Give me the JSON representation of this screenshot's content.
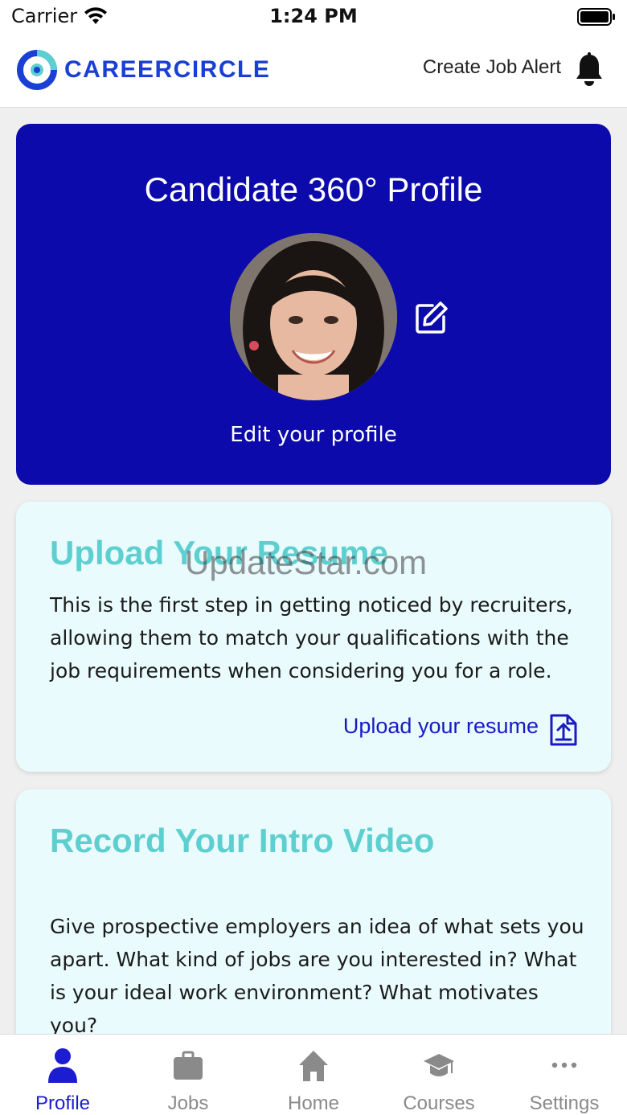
{
  "status_bar": {
    "carrier": "Carrier",
    "time": "1:24 PM"
  },
  "header": {
    "logo_text": "CAREERCIRCLE",
    "job_alert_label": "Create Job Alert"
  },
  "profile_card": {
    "title": "Candidate 360° Profile",
    "edit_label": "Edit your profile"
  },
  "resume_card": {
    "heading": "Upload Your Resume",
    "body": "This is the first step in getting noticed by recruiters, allowing them to match your qualifications with the job requirements when considering you for a role.",
    "link_label": "Upload your resume"
  },
  "video_card": {
    "heading": "Record Your Intro Video",
    "body": "Give prospective employers an idea of what sets you apart. What kind of jobs are you interested in? What is your ideal work environment? What motivates you?"
  },
  "watermark": "UpdateStar.com",
  "tabs": [
    {
      "label": "Profile",
      "icon": "person-icon",
      "active": true
    },
    {
      "label": "Jobs",
      "icon": "briefcase-icon",
      "active": false
    },
    {
      "label": "Home",
      "icon": "home-icon",
      "active": false
    },
    {
      "label": "Courses",
      "icon": "graduation-cap-icon",
      "active": false
    },
    {
      "label": "Settings",
      "icon": "more-icon",
      "active": false
    }
  ],
  "colors": {
    "brand_blue": "#1a3fd4",
    "profile_card_bg": "#0c0aaa",
    "heading_teal": "#5ecfd0",
    "card_bg": "#e9fbfc",
    "link_blue": "#1a1ac4",
    "tab_active": "#1c1cd0",
    "tab_inactive": "#8a8a8a"
  }
}
